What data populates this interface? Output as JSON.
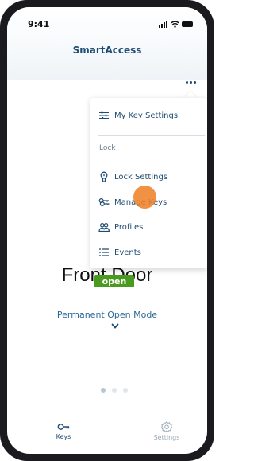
{
  "status_bar": {
    "time": "9:41"
  },
  "header": {
    "title": "SmartAccess",
    "more_icon": "more-dots-icon"
  },
  "lock": {
    "name": "Front Door",
    "status": "open",
    "mode": "Permanent Open Mode",
    "status_color": "#4a9a1f"
  },
  "menu": {
    "top_item": {
      "label": "My Key Settings",
      "icon": "sliders-icon"
    },
    "section_label": "Lock",
    "items": [
      {
        "label": "Lock Settings",
        "icon": "lock-icon"
      },
      {
        "label": "Manage Keys",
        "icon": "keys-icon"
      },
      {
        "label": "Profiles",
        "icon": "users-icon"
      },
      {
        "label": "Events",
        "icon": "list-icon"
      }
    ]
  },
  "pager": {
    "pages": 3,
    "current": 1
  },
  "tabs": [
    {
      "label": "Keys",
      "icon": "key-icon",
      "active": true
    },
    {
      "label": "Settings",
      "icon": "gear-icon",
      "active": false
    }
  ],
  "colors": {
    "accent": "#1f4c72",
    "link": "#2a6a98",
    "touch_indicator": "#ee822a"
  }
}
